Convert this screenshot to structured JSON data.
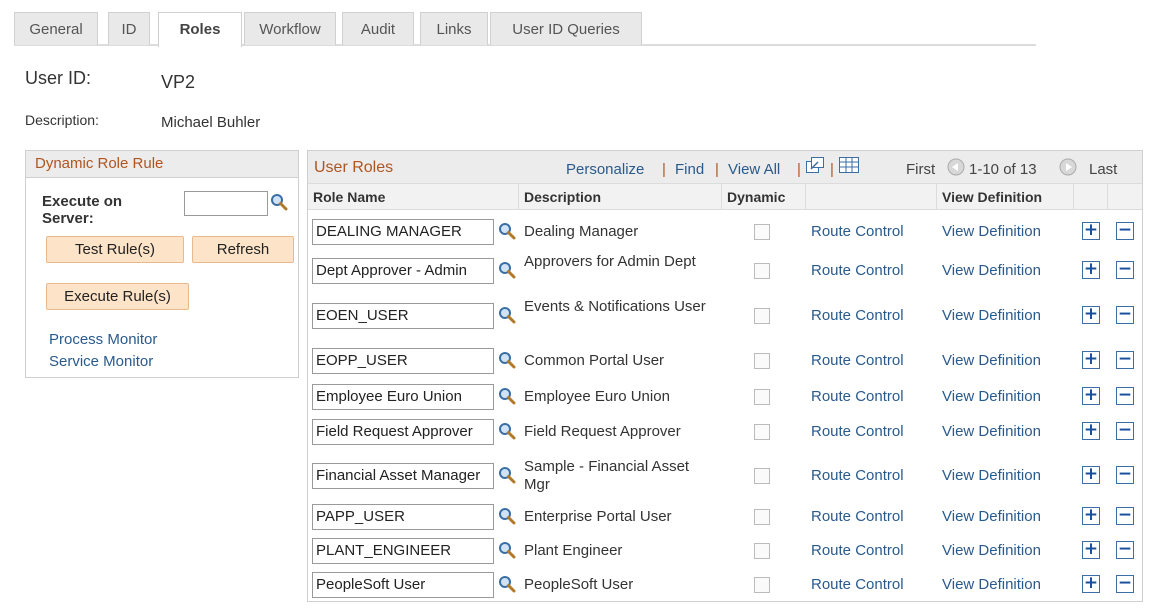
{
  "tabs": [
    "General",
    "ID",
    "Roles",
    "Workflow",
    "Audit",
    "Links",
    "User ID Queries"
  ],
  "user": {
    "id_label": "User ID:",
    "id_value": "VP2",
    "desc_label": "Description:",
    "desc_value": "Michael Buhler"
  },
  "dynamic_role_rule": {
    "title": "Dynamic Role Rule",
    "execute_on_label": "Execute on",
    "server_label": "Server:",
    "server_value": "",
    "test_button": "Test Rule(s)",
    "refresh_button": "Refresh",
    "execute_button": "Execute Rule(s)",
    "process_monitor": "Process Monitor",
    "service_monitor": "Service Monitor"
  },
  "user_roles": {
    "title": "User Roles",
    "personalize": "Personalize",
    "find": "Find",
    "view_all": "View All",
    "sep": "|",
    "first": "First",
    "range": "1-10 of 13",
    "last": "Last",
    "columns": [
      "Role Name",
      "Description",
      "Dynamic",
      "",
      "View Definition"
    ],
    "rows": [
      {
        "role": "DEALING MANAGER",
        "desc": "Dealing Manager",
        "route": "Route Control",
        "view": "View Definition"
      },
      {
        "role": "Dept Approver - Admin",
        "desc": "Approvers for Admin Dept",
        "route": "Route Control",
        "view": "View Definition"
      },
      {
        "role": "EOEN_USER",
        "desc": "Events & Notifications User",
        "route": "Route Control",
        "view": "View Definition"
      },
      {
        "role": "EOPP_USER",
        "desc": "Common Portal User",
        "route": "Route Control",
        "view": "View Definition"
      },
      {
        "role": "Employee Euro Union",
        "desc": "Employee Euro Union",
        "route": "Route Control",
        "view": "View Definition"
      },
      {
        "role": "Field Request Approver",
        "desc": "Field Request Approver",
        "route": "Route Control",
        "view": "View Definition"
      },
      {
        "role": "Financial Asset Manager",
        "desc": "Sample - Financial Asset Mgr",
        "route": "Route Control",
        "view": "View Definition"
      },
      {
        "role": "PAPP_USER",
        "desc": "Enterprise Portal User",
        "route": "Route Control",
        "view": "View Definition"
      },
      {
        "role": "PLANT_ENGINEER",
        "desc": "Plant Engineer",
        "route": "Route Control",
        "view": "View Definition"
      },
      {
        "role": "PeopleSoft User",
        "desc": "PeopleSoft User",
        "route": "Route Control",
        "view": "View Definition"
      }
    ]
  },
  "colors": {
    "link": "#2a5a8c",
    "section_title": "#b0551e",
    "button_bg": "#fde4c9"
  }
}
